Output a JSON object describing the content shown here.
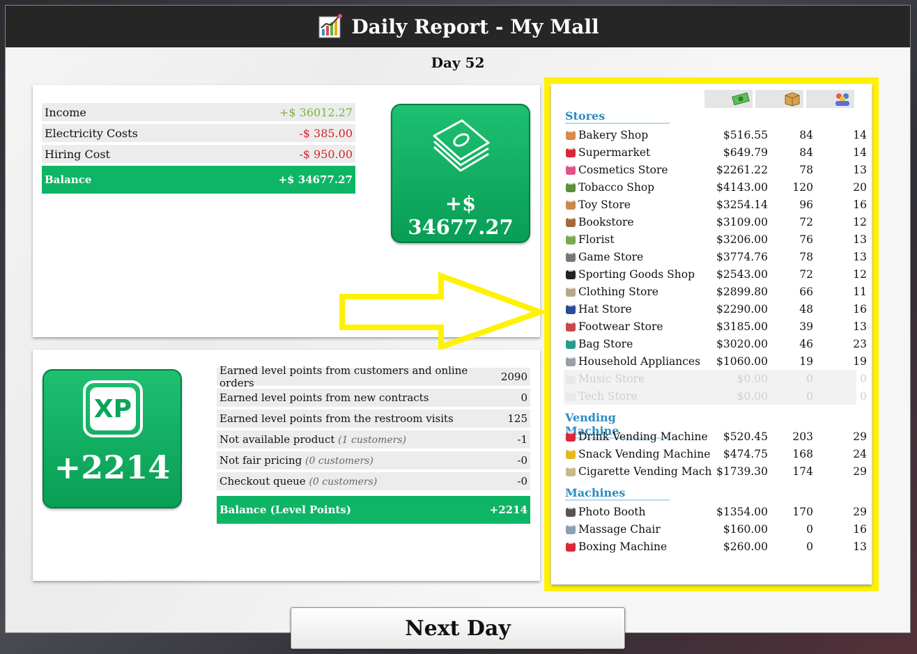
{
  "window": {
    "title": "Daily Report - My Mall",
    "day_label": "Day 52"
  },
  "finance": {
    "rows": [
      {
        "label": "Income",
        "value": "+$ 36012.27",
        "tone": "pos"
      },
      {
        "label": "Electricity Costs",
        "value": "-$ 385.00",
        "tone": "neg"
      },
      {
        "label": "Hiring Cost",
        "value": "-$ 950.00",
        "tone": "neg"
      }
    ],
    "balance_label": "Balance",
    "balance_value": "+$ 34677.27",
    "card_value": "+$ 34677.27"
  },
  "xp": {
    "card_icon_text": "XP",
    "card_value": "+2214",
    "rows": [
      {
        "label": "Earned level points from customers and online orders",
        "note": "",
        "value": "2090"
      },
      {
        "label": "Earned level points from new contracts",
        "note": "",
        "value": "0"
      },
      {
        "label": "Earned level points from the restroom visits",
        "note": "",
        "value": "125"
      },
      {
        "label": "Not available product",
        "note": "(1 customers)",
        "value": "-1"
      },
      {
        "label": "Not fair pricing",
        "note": "(0 customers)",
        "value": "-0"
      },
      {
        "label": "Checkout queue",
        "note": "(0 customers)",
        "value": "-0"
      }
    ],
    "balance_label": "Balance (Level Points)",
    "balance_value": "+2214"
  },
  "stores_panel": {
    "header_icons": [
      "money-icon",
      "box-icon",
      "customers-icon"
    ],
    "sections": [
      {
        "title": "Stores",
        "rows": [
          {
            "icon": "bakery",
            "name": "Bakery Shop",
            "revenue": "$516.55",
            "sold": "84",
            "customers": "14",
            "disabled": false
          },
          {
            "icon": "supermarket",
            "name": "Supermarket",
            "revenue": "$649.79",
            "sold": "84",
            "customers": "14",
            "disabled": false
          },
          {
            "icon": "cosmetics",
            "name": "Cosmetics Store",
            "revenue": "$2261.22",
            "sold": "78",
            "customers": "13",
            "disabled": false
          },
          {
            "icon": "tobacco",
            "name": "Tobacco Shop",
            "revenue": "$4143.00",
            "sold": "120",
            "customers": "20",
            "disabled": false
          },
          {
            "icon": "toy",
            "name": "Toy Store",
            "revenue": "$3254.14",
            "sold": "96",
            "customers": "16",
            "disabled": false
          },
          {
            "icon": "book",
            "name": "Bookstore",
            "revenue": "$3109.00",
            "sold": "72",
            "customers": "12",
            "disabled": false
          },
          {
            "icon": "florist",
            "name": "Florist",
            "revenue": "$3206.00",
            "sold": "76",
            "customers": "13",
            "disabled": false
          },
          {
            "icon": "game",
            "name": "Game Store",
            "revenue": "$3774.76",
            "sold": "78",
            "customers": "13",
            "disabled": false
          },
          {
            "icon": "sport",
            "name": "Sporting Goods Shop",
            "revenue": "$2543.00",
            "sold": "72",
            "customers": "12",
            "disabled": false
          },
          {
            "icon": "clothing",
            "name": "Clothing Store",
            "revenue": "$2899.80",
            "sold": "66",
            "customers": "11",
            "disabled": false
          },
          {
            "icon": "hat",
            "name": "Hat Store",
            "revenue": "$2290.00",
            "sold": "48",
            "customers": "16",
            "disabled": false
          },
          {
            "icon": "footwear",
            "name": "Footwear Store",
            "revenue": "$3185.00",
            "sold": "39",
            "customers": "13",
            "disabled": false
          },
          {
            "icon": "bag",
            "name": "Bag Store",
            "revenue": "$3020.00",
            "sold": "46",
            "customers": "23",
            "disabled": false
          },
          {
            "icon": "appliance",
            "name": "Household Appliances",
            "revenue": "$1060.00",
            "sold": "19",
            "customers": "19",
            "disabled": false
          },
          {
            "icon": "music",
            "name": "Music Store",
            "revenue": "$0.00",
            "sold": "0",
            "customers": "0",
            "disabled": true
          },
          {
            "icon": "tech",
            "name": "Tech Store",
            "revenue": "$0.00",
            "sold": "0",
            "customers": "0",
            "disabled": true
          }
        ]
      },
      {
        "title": "Vending Machine",
        "rows": [
          {
            "icon": "drink",
            "name": "Drink Vending Machine",
            "revenue": "$520.45",
            "sold": "203",
            "customers": "29",
            "disabled": false
          },
          {
            "icon": "snack",
            "name": "Snack Vending Machine",
            "revenue": "$474.75",
            "sold": "168",
            "customers": "24",
            "disabled": false
          },
          {
            "icon": "cigarette",
            "name": "Cigarette Vending Machine",
            "revenue": "$1739.30",
            "sold": "174",
            "customers": "29",
            "disabled": false
          }
        ]
      },
      {
        "title": "Machines",
        "rows": [
          {
            "icon": "photo",
            "name": "Photo Booth",
            "revenue": "$1354.00",
            "sold": "170",
            "customers": "29",
            "disabled": false
          },
          {
            "icon": "massage",
            "name": "Massage Chair",
            "revenue": "$160.00",
            "sold": "0",
            "customers": "16",
            "disabled": false
          },
          {
            "icon": "boxing",
            "name": "Boxing Machine",
            "revenue": "$260.00",
            "sold": "0",
            "customers": "13",
            "disabled": false
          }
        ]
      }
    ]
  },
  "buttons": {
    "next_day": "Next Day"
  },
  "colors": {
    "accent_green": "#0db565",
    "section_blue": "#2a8cc4",
    "positive": "#7ab33a",
    "negative": "#d3222f",
    "highlight_yellow": "#fff200"
  }
}
